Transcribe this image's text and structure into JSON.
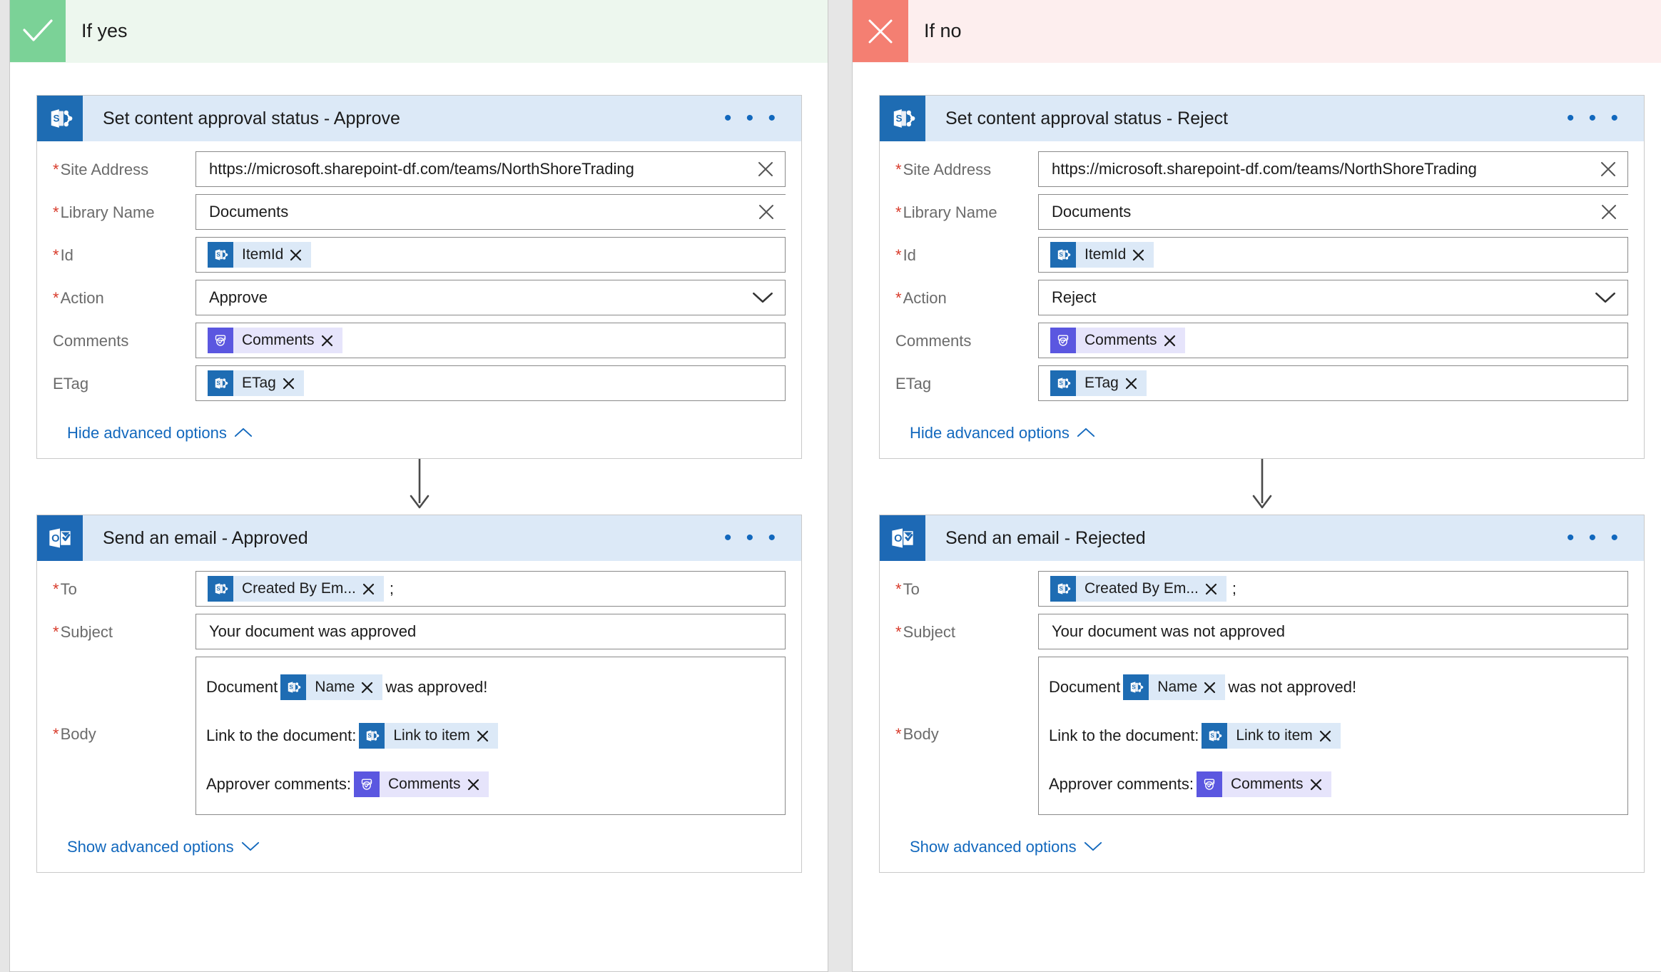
{
  "branches": [
    {
      "id": "if-yes",
      "title": "If yes",
      "icon": "check-icon",
      "icon_bg": "#7bd297",
      "header_bg": "#edf7ee",
      "sharepoint_card": {
        "title": "Set content approval status - Approve",
        "app_icon": "sharepoint-icon",
        "menu": "• • •",
        "fields": [
          {
            "label": "Site Address",
            "required": true,
            "kind": "text-clear",
            "value": "https://microsoft.sharepoint-df.com/teams/NorthShoreTrading"
          },
          {
            "label": "Library Name",
            "required": true,
            "kind": "text-clear-openend",
            "value": "Documents"
          },
          {
            "label": "Id",
            "required": true,
            "kind": "token",
            "token": {
              "label": "ItemId",
              "icon": "sharepoint-icon",
              "style": "sharepoint"
            }
          },
          {
            "label": "Action",
            "required": true,
            "kind": "dropdown",
            "value": "Approve"
          },
          {
            "label": "Comments",
            "required": false,
            "kind": "token",
            "token": {
              "label": "Comments",
              "icon": "approvals-icon",
              "style": "approval"
            }
          },
          {
            "label": "ETag",
            "required": false,
            "kind": "token",
            "token": {
              "label": "ETag",
              "icon": "sharepoint-icon",
              "style": "sharepoint"
            }
          }
        ],
        "advanced_link": "Hide advanced options",
        "advanced_chevron": "chevron-up-icon"
      },
      "email_card": {
        "title": "Send an email - Approved",
        "app_icon": "outlook-icon",
        "menu": "• • •",
        "to": {
          "label": "To",
          "required": true,
          "token": {
            "label": "Created By Em...",
            "icon": "sharepoint-icon",
            "style": "sharepoint"
          },
          "trailing": ";"
        },
        "subject": {
          "label": "Subject",
          "required": true,
          "value": "Your document was approved"
        },
        "body": {
          "label": "Body",
          "required": true,
          "lines": [
            {
              "pre": "Document",
              "token": {
                "label": "Name",
                "icon": "sharepoint-icon",
                "style": "sharepoint"
              },
              "post": "was approved!"
            },
            {
              "pre": "Link to the document:",
              "token": {
                "label": "Link to item",
                "icon": "sharepoint-icon",
                "style": "sharepoint"
              },
              "post": ""
            },
            {
              "pre": "Approver comments:",
              "token": {
                "label": "Comments",
                "icon": "approvals-icon",
                "style": "approval"
              },
              "post": ""
            }
          ]
        },
        "advanced_link": "Show advanced options",
        "advanced_chevron": "chevron-down-icon"
      }
    },
    {
      "id": "if-no",
      "title": "If no",
      "icon": "close-icon",
      "icon_bg": "#f47f72",
      "header_bg": "#fdeeee",
      "sharepoint_card": {
        "title": "Set content approval status - Reject",
        "app_icon": "sharepoint-icon",
        "menu": "• • •",
        "fields": [
          {
            "label": "Site Address",
            "required": true,
            "kind": "text-clear",
            "value": "https://microsoft.sharepoint-df.com/teams/NorthShoreTrading"
          },
          {
            "label": "Library Name",
            "required": true,
            "kind": "text-clear-openend",
            "value": "Documents"
          },
          {
            "label": "Id",
            "required": true,
            "kind": "token",
            "token": {
              "label": "ItemId",
              "icon": "sharepoint-icon",
              "style": "sharepoint"
            }
          },
          {
            "label": "Action",
            "required": true,
            "kind": "dropdown",
            "value": "Reject"
          },
          {
            "label": "Comments",
            "required": false,
            "kind": "token",
            "token": {
              "label": "Comments",
              "icon": "approvals-icon",
              "style": "approval"
            }
          },
          {
            "label": "ETag",
            "required": false,
            "kind": "token",
            "token": {
              "label": "ETag",
              "icon": "sharepoint-icon",
              "style": "sharepoint"
            }
          }
        ],
        "advanced_link": "Hide advanced options",
        "advanced_chevron": "chevron-up-icon"
      },
      "email_card": {
        "title": "Send an email - Rejected",
        "app_icon": "outlook-icon",
        "menu": "• • •",
        "to": {
          "label": "To",
          "required": true,
          "token": {
            "label": "Created By Em...",
            "icon": "sharepoint-icon",
            "style": "sharepoint"
          },
          "trailing": ";"
        },
        "subject": {
          "label": "Subject",
          "required": true,
          "value": "Your document was not approved"
        },
        "body": {
          "label": "Body",
          "required": true,
          "lines": [
            {
              "pre": "Document",
              "token": {
                "label": "Name",
                "icon": "sharepoint-icon",
                "style": "sharepoint"
              },
              "post": "was not approved!"
            },
            {
              "pre": "Link to the document:",
              "token": {
                "label": "Link to item",
                "icon": "sharepoint-icon",
                "style": "sharepoint"
              },
              "post": ""
            },
            {
              "pre": "Approver comments:",
              "token": {
                "label": "Comments",
                "icon": "approvals-icon",
                "style": "approval"
              },
              "post": ""
            }
          ]
        },
        "advanced_link": "Show advanced options",
        "advanced_chevron": "chevron-down-icon"
      }
    }
  ],
  "colors": {
    "sharepoint_blue": "#1e6cb3",
    "outlook_blue": "#1d69b5",
    "approval_purple": "#5b57e0",
    "card_header_bg": "#dce9f7",
    "token_bg": "#dce9f7",
    "token_approval_bg": "#e6e4fb",
    "link_blue": "#1268bd",
    "required_red": "#d83b2b",
    "canvas_bg": "#e6e6e6"
  }
}
